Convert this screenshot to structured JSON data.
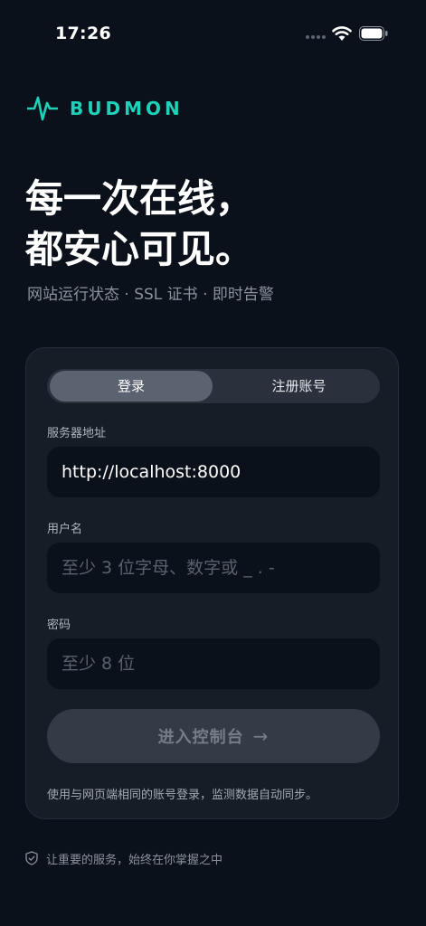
{
  "status_bar": {
    "time": "17:26"
  },
  "brand": {
    "name": "BUDMON",
    "accent_color": "#1fd1b8",
    "logo_icon": "pulse-icon"
  },
  "hero": {
    "title_line1": "每一次在线，",
    "title_line2": "都安心可见。",
    "subtitle": "网站运行状态 · SSL 证书 · 即时告警"
  },
  "auth_card": {
    "tabs": [
      {
        "label": "登录",
        "active": true
      },
      {
        "label": "注册账号",
        "active": false
      }
    ],
    "server": {
      "label": "服务器地址",
      "value": "http://localhost:8000"
    },
    "username": {
      "label": "用户名",
      "placeholder": "至少 3 位字母、数字或 _ . -"
    },
    "password": {
      "label": "密码",
      "placeholder": "至少 8 位"
    },
    "submit_label": "进入控制台",
    "submit_arrow": "→",
    "note": "使用与网页端相同的账号登录，监测数据自动同步。"
  },
  "footer": {
    "text": "让重要的服务，始终在你掌握之中",
    "icon": "shield-check-icon"
  }
}
